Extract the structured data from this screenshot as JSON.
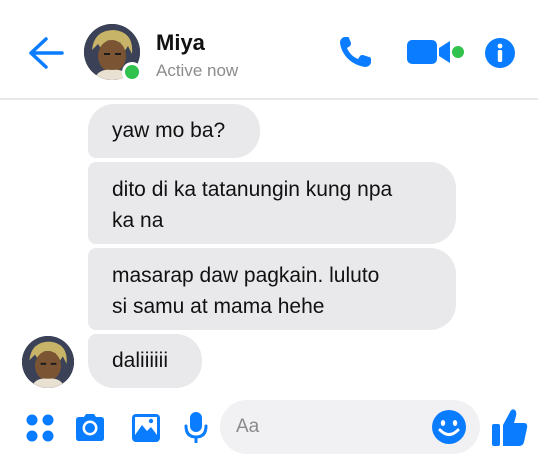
{
  "header": {
    "contact_name": "Miya",
    "status": "Active now",
    "accent_color": "#0a7cff",
    "online_color": "#31c24d",
    "icons": [
      "back-arrow-icon",
      "phone-icon",
      "video-camera-icon",
      "info-icon"
    ]
  },
  "messages": [
    {
      "text": "yaw mo ba?"
    },
    {
      "text": "dito di ka tatanungin kung npa\nka na"
    },
    {
      "text": "masarap daw pagkain. luluto\nsi samu at mama hehe"
    },
    {
      "text": "daliiiiii"
    }
  ],
  "composer": {
    "placeholder": "Aa",
    "icons": [
      "apps-grid-icon",
      "camera-icon",
      "image-icon",
      "microphone-icon",
      "emoji-icon",
      "thumbs-up-icon"
    ]
  }
}
